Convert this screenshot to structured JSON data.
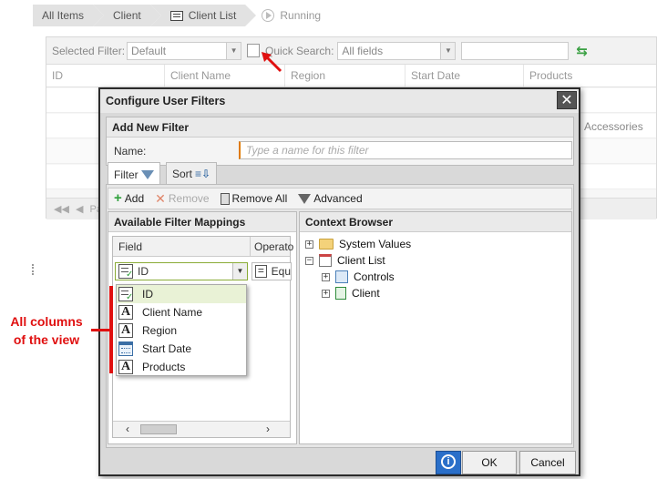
{
  "breadcrumb": {
    "items": [
      {
        "label": "All Items"
      },
      {
        "label": "Client"
      },
      {
        "label": "Client List"
      }
    ],
    "running": "Running"
  },
  "view": {
    "toolbar": {
      "selected_filter_label": "Selected Filter:",
      "selected_filter_value": "Default",
      "quick_search_label": "Quick Search:",
      "quick_search_value": "All fields",
      "search_value": ""
    },
    "columns": [
      "ID",
      "Client Name",
      "Region",
      "Start Date",
      "Products"
    ],
    "partial_cell": "Accessories",
    "pager_text": "Pa"
  },
  "dialog": {
    "title": "Configure User Filters",
    "add_new_filter": "Add New Filter",
    "name_label": "Name:",
    "name_placeholder": "Type a name for this filter",
    "tabs": [
      {
        "label": "Filter"
      },
      {
        "label": "Sort"
      }
    ],
    "actions": {
      "add": "Add",
      "remove": "Remove",
      "remove_all": "Remove All",
      "advanced": "Advanced"
    },
    "mappings": {
      "title": "Available Filter Mappings",
      "field_header": "Field",
      "operator_header": "Operato",
      "selected_field": "ID",
      "selected_operator": "Equ",
      "options": [
        {
          "label": "ID",
          "icon": "id-icon"
        },
        {
          "label": "Client Name",
          "icon": "text-icon"
        },
        {
          "label": "Region",
          "icon": "text-icon"
        },
        {
          "label": "Start Date",
          "icon": "date-icon"
        },
        {
          "label": "Products",
          "icon": "text-icon"
        }
      ]
    },
    "context": {
      "title": "Context Browser",
      "nodes": [
        {
          "label": "System Values"
        },
        {
          "label": "Client List"
        },
        {
          "label": "Controls"
        },
        {
          "label": "Client"
        }
      ]
    },
    "ok": "OK",
    "cancel": "Cancel"
  },
  "annotation": {
    "line1": "All columns",
    "line2": "of the view"
  },
  "colors": {
    "annotation": "#e01010",
    "combo_border": "#8aac37",
    "info_button": "#2a6fc9"
  }
}
